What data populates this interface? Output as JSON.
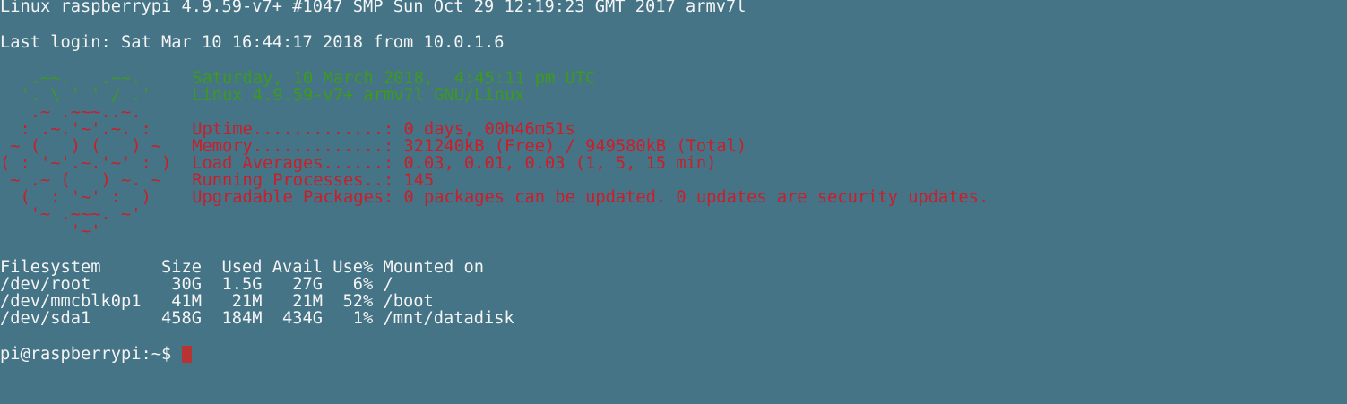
{
  "terminal": {
    "kernel_line": "Linux raspberrypi 4.9.59-v7+ #1047 SMP Sun Oct 29 12:19:23 GMT 2017 armv7l",
    "last_login": "Last login: Sat Mar 10 16:44:17 2018 from 10.0.1.6",
    "motd": {
      "art": [
        "   .~~.   .~~.   ",
        "  '. \\ ' ' / .'  ",
        "   .~ .~~~..~.   ",
        "  : .~.'~'.~. :  ",
        " ~ (   ) (   ) ~ ",
        "( : '~'.~.'~' : )",
        " ~ .~ (   ) ~. ~ ",
        "  (  : '~' :  )  ",
        "   '~ .~~~. ~'   ",
        "       '~'       "
      ],
      "date": "Saturday, 10 March 2018,  4:45:11 pm UTC",
      "os": "Linux 4.9.59-v7+ armv7l GNU/Linux",
      "stats": [
        {
          "label": "Uptime.............:",
          "value": " 0 days, 00h46m51s"
        },
        {
          "label": "Memory.............:",
          "value": " 321240kB (Free) / 949580kB (Total)"
        },
        {
          "label": "Load Averages......:",
          "value": " 0.03, 0.01, 0.03 (1, 5, 15 min)"
        },
        {
          "label": "Running Processes..:",
          "value": " 145"
        },
        {
          "label": "Upgradable Packages:",
          "value": " 0 packages can be updated. 0 updates are security updates."
        }
      ]
    },
    "df": {
      "header": "Filesystem      Size  Used Avail Use% Mounted on",
      "rows": [
        "/dev/root        30G  1.5G   27G   6% /",
        "/dev/mmcblk0p1   41M   21M   21M  52% /boot",
        "/dev/sda1       458G  184M  434G   1% /mnt/datadisk"
      ]
    },
    "prompt": "pi@raspberrypi:~$ ",
    "colors": {
      "background": "#457487",
      "text": "#f4f4f4",
      "green": "#3e9a1c",
      "red": "#cc1d28",
      "cursor": "#b83434"
    }
  }
}
